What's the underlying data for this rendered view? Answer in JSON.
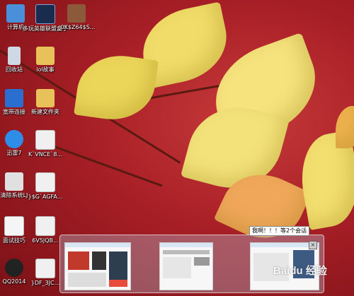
{
  "desktop": {
    "icons": [
      {
        "label": "计算机",
        "icon": "computer-icon",
        "color": "#4a8fd9"
      },
      {
        "label": "多玩英雄联盟盒子",
        "icon": "game-box-icon",
        "color": "#1a2c4d"
      },
      {
        "label": "_0K$Z64$S...",
        "icon": "image-file-icon",
        "color": "#8a5a3a"
      },
      {
        "label": "回收站",
        "icon": "recycle-bin-icon",
        "color": "#cfd9e6"
      },
      {
        "label": "lol故事",
        "icon": "folder-icon",
        "color": "#e8c15a"
      },
      {
        "label": "宽带连接",
        "icon": "network-connection-icon",
        "color": "#2a6fd0"
      },
      {
        "label": "新建文件夹",
        "icon": "folder-icon",
        "color": "#e8c15a"
      },
      {
        "label": "迅雷7",
        "icon": "thunder-icon",
        "color": "#2e8de6"
      },
      {
        "label": "K`VNCE`8...",
        "icon": "image-file-icon",
        "color": "#f0f0f0"
      },
      {
        "label": "清除系统LJ",
        "icon": "batch-file-icon",
        "color": "#e0e0e0"
      },
      {
        "label": "}$G`AGFA...",
        "icon": "image-file-icon",
        "color": "#f0f0f0"
      },
      {
        "label": "面试技巧",
        "icon": "document-icon",
        "color": "#f5f5f5"
      },
      {
        "label": "6V5JQB...",
        "icon": "image-file-icon",
        "color": "#f0f0f0"
      },
      {
        "label": "QQ2014",
        "icon": "qq-icon",
        "color": "#222222"
      },
      {
        "label": "}DF_3JC...",
        "icon": "image-file-icon",
        "color": "#f0f0f0"
      }
    ]
  },
  "taskbar_preview": {
    "tooltip": "我啊！！！等2个会话",
    "close_symbol": "×",
    "thumbnails": [
      "window-thumbnail-1",
      "window-thumbnail-2",
      "window-thumbnail-3"
    ]
  },
  "watermark": {
    "text": "Baidu 经验"
  },
  "colors": {
    "wallpaper": "#a81f26",
    "leaf": "#f0d860"
  }
}
